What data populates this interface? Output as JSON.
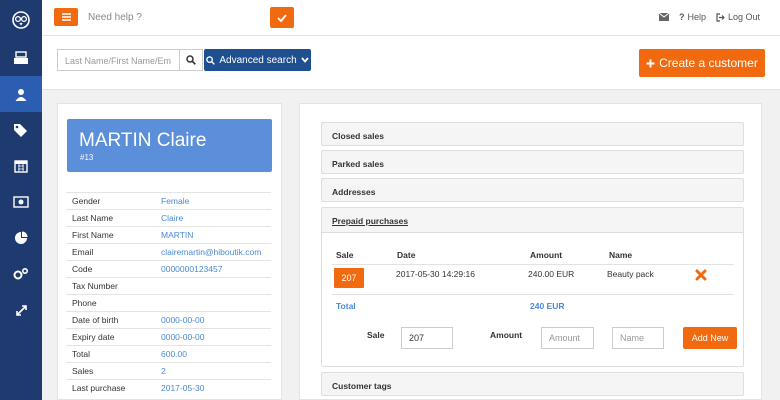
{
  "colors": {
    "sidebar": "#1e3a6e",
    "sidebar_active": "#2b5db0",
    "accent": "#f26a10",
    "primary": "#1e4f8f",
    "card": "#5b8fd9",
    "link": "#4a89d6"
  },
  "sidebar": {
    "items": [
      {
        "icon": "logo-icon"
      },
      {
        "icon": "register-icon"
      },
      {
        "icon": "customer-icon",
        "active": true
      },
      {
        "icon": "tags-icon"
      },
      {
        "icon": "calendar-icon"
      },
      {
        "icon": "money-icon"
      },
      {
        "icon": "pie-chart-icon"
      },
      {
        "icon": "settings-icon"
      },
      {
        "icon": "expand-icon"
      }
    ]
  },
  "header": {
    "help_placeholder": "Need help ?",
    "help_label": "Help",
    "logout_label": "Log Out"
  },
  "search": {
    "placeholder": "Last Name/First Name/Em",
    "advanced_label": "Advanced search",
    "create_label": "Create a customer"
  },
  "customer": {
    "name": "MARTIN Claire",
    "number": "#13",
    "fields": [
      {
        "label": "Gender",
        "value": "Female"
      },
      {
        "label": "Last Name",
        "value": "Claire"
      },
      {
        "label": "First Name",
        "value": "MARTIN"
      },
      {
        "label": "Email",
        "value": "clairemartin@hiboutik.com"
      },
      {
        "label": "Code",
        "value": "0000000123457"
      },
      {
        "label": "Tax Number",
        "value": ""
      },
      {
        "label": "Phone",
        "value": ""
      },
      {
        "label": "Date of birth",
        "value": "0000-00-00"
      },
      {
        "label": "Expiry date",
        "value": "0000-00-00"
      },
      {
        "label": "Total",
        "value": "600.00"
      },
      {
        "label": "Sales",
        "value": "2"
      },
      {
        "label": "Last purchase",
        "value": "2017-05-30"
      }
    ]
  },
  "sections": {
    "closed_sales": "Closed sales",
    "parked_sales": "Parked sales",
    "addresses": "Addresses",
    "prepaid": "Prepaid purchases",
    "customer_tags": "Customer tags"
  },
  "prepaid": {
    "headers": {
      "sale": "Sale",
      "date": "Date",
      "amount": "Amount",
      "name": "Name"
    },
    "row": {
      "sale": "207",
      "date": "2017-05-30 14:29:16",
      "amount": "240.00 EUR",
      "name": "Beauty pack"
    },
    "total_label": "Total",
    "total_value": "240 EUR",
    "form": {
      "sale_label": "Sale",
      "sale_value": "207",
      "amount_label": "Amount",
      "amount_placeholder": "Amount",
      "name_placeholder": "Name",
      "add_label": "Add New"
    }
  }
}
